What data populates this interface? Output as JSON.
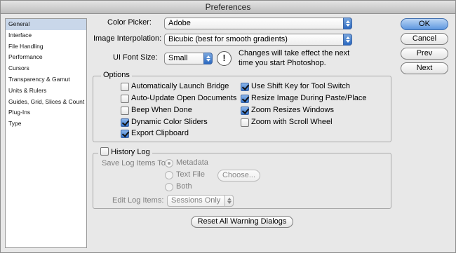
{
  "window": {
    "title": "Preferences"
  },
  "sidebar": {
    "items": [
      {
        "label": "General"
      },
      {
        "label": "Interface"
      },
      {
        "label": "File Handling"
      },
      {
        "label": "Performance"
      },
      {
        "label": "Cursors"
      },
      {
        "label": "Transparency & Gamut"
      },
      {
        "label": "Units & Rulers"
      },
      {
        "label": "Guides, Grid, Slices & Count"
      },
      {
        "label": "Plug-Ins"
      },
      {
        "label": "Type"
      }
    ]
  },
  "general": {
    "color_picker": {
      "label": "Color Picker:",
      "value": "Adobe"
    },
    "image_interpolation": {
      "label": "Image Interpolation:",
      "value": "Bicubic (best for smooth gradients)"
    },
    "ui_font_size": {
      "label": "UI Font Size:",
      "value": "Small",
      "note_line1": "Changes will take effect the next",
      "note_line2": "time you start Photoshop."
    },
    "options": {
      "title": "Options",
      "items": [
        {
          "label": "Automatically Launch Bridge",
          "checked": false
        },
        {
          "label": "Auto-Update Open Documents",
          "checked": false
        },
        {
          "label": "Beep When Done",
          "checked": false
        },
        {
          "label": "Dynamic Color Sliders",
          "checked": true
        },
        {
          "label": "Export Clipboard",
          "checked": true
        },
        {
          "label": "Use Shift Key for Tool Switch",
          "checked": true
        },
        {
          "label": "Resize Image During Paste/Place",
          "checked": true
        },
        {
          "label": "Zoom Resizes Windows",
          "checked": true
        },
        {
          "label": "Zoom with Scroll Wheel",
          "checked": false
        }
      ]
    },
    "history_log": {
      "title": "History Log",
      "checked": false,
      "save_label": "Save Log Items To:",
      "radio_metadata": "Metadata",
      "radio_text_file": "Text File",
      "choose_button": "Choose...",
      "radio_both": "Both",
      "edit_label": "Edit Log Items:",
      "edit_value": "Sessions Only"
    },
    "reset_button": "Reset All Warning Dialogs"
  },
  "buttons": {
    "ok": "OK",
    "cancel": "Cancel",
    "prev": "Prev",
    "next": "Next"
  }
}
